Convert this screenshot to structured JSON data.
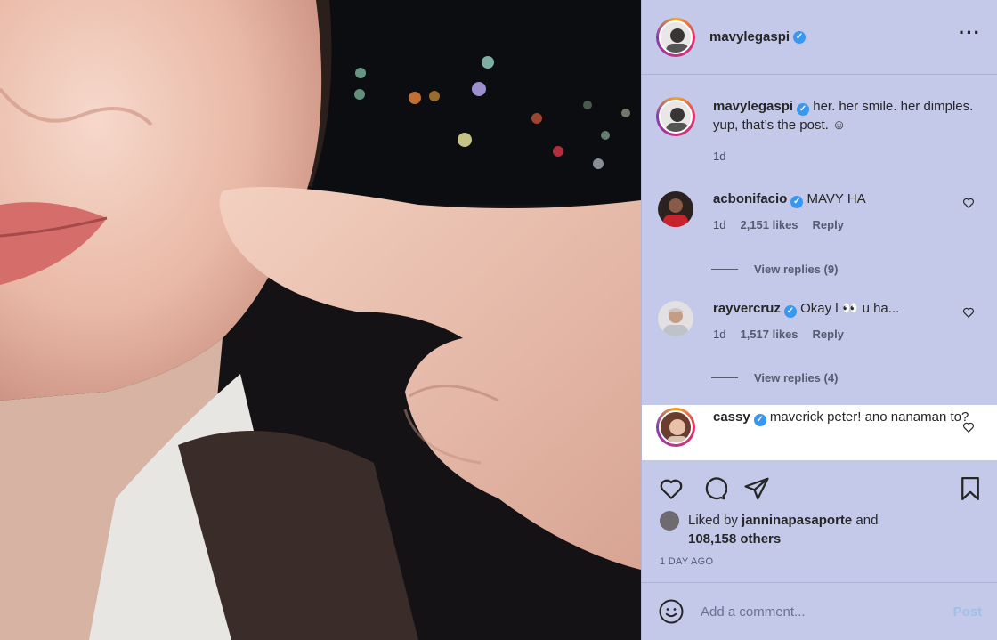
{
  "post": {
    "author": "mavylegaspi",
    "verified_mark": "✓",
    "more_label": "···"
  },
  "comments": [
    {
      "username": "mavylegaspi",
      "text": "her. her smile. her dimples. yup, that’s the post. ☺",
      "age": "1d",
      "likes": "",
      "reply_label": ""
    },
    {
      "username": "acbonifacio",
      "text": "MAVY HA",
      "age": "1d",
      "likes": "2,151 likes",
      "reply_label": "Reply",
      "view_replies": "View replies (9)"
    },
    {
      "username": "rayvercruz",
      "text": "Okay l 👀 u ha...",
      "age": "1d",
      "likes": "1,517 likes",
      "reply_label": "Reply",
      "view_replies": "View replies (4)"
    },
    {
      "username": "cassy",
      "text": "maverick peter! ano nanaman to?",
      "age": "",
      "likes": "",
      "reply_label": ""
    }
  ],
  "liked_by": {
    "prefix": "Liked by",
    "user": "janninapasaporte",
    "suffix": "and",
    "others": "108,158 others"
  },
  "timestamp": "1 DAY AGO",
  "add_comment": {
    "placeholder": "Add a comment...",
    "post_label": "Post"
  },
  "icons": [
    "more-icon",
    "heart-icon",
    "comment-icon",
    "share-icon",
    "bookmark-icon",
    "emoji-icon"
  ],
  "colors": {
    "panel_bg": "#c4c9ea",
    "verified": "#3897f0",
    "post_button": "#9fbfe9"
  }
}
